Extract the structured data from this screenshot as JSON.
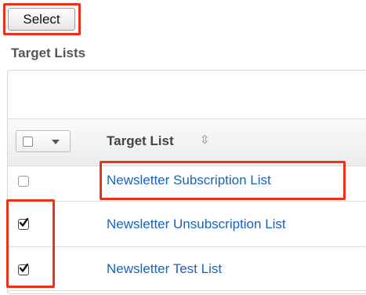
{
  "toolbar": {
    "select_label": "Select"
  },
  "section": {
    "title": "Target Lists"
  },
  "table": {
    "column_header": "Target List",
    "sort_icon": "⇳",
    "rows": [
      {
        "name": "Newsletter Subscription List",
        "checked": false
      },
      {
        "name": "Newsletter Unsubscription List",
        "checked": true
      },
      {
        "name": "Newsletter Test List",
        "checked": true
      }
    ]
  },
  "colors": {
    "highlight": "#e8321c",
    "link": "#1a63b5"
  }
}
